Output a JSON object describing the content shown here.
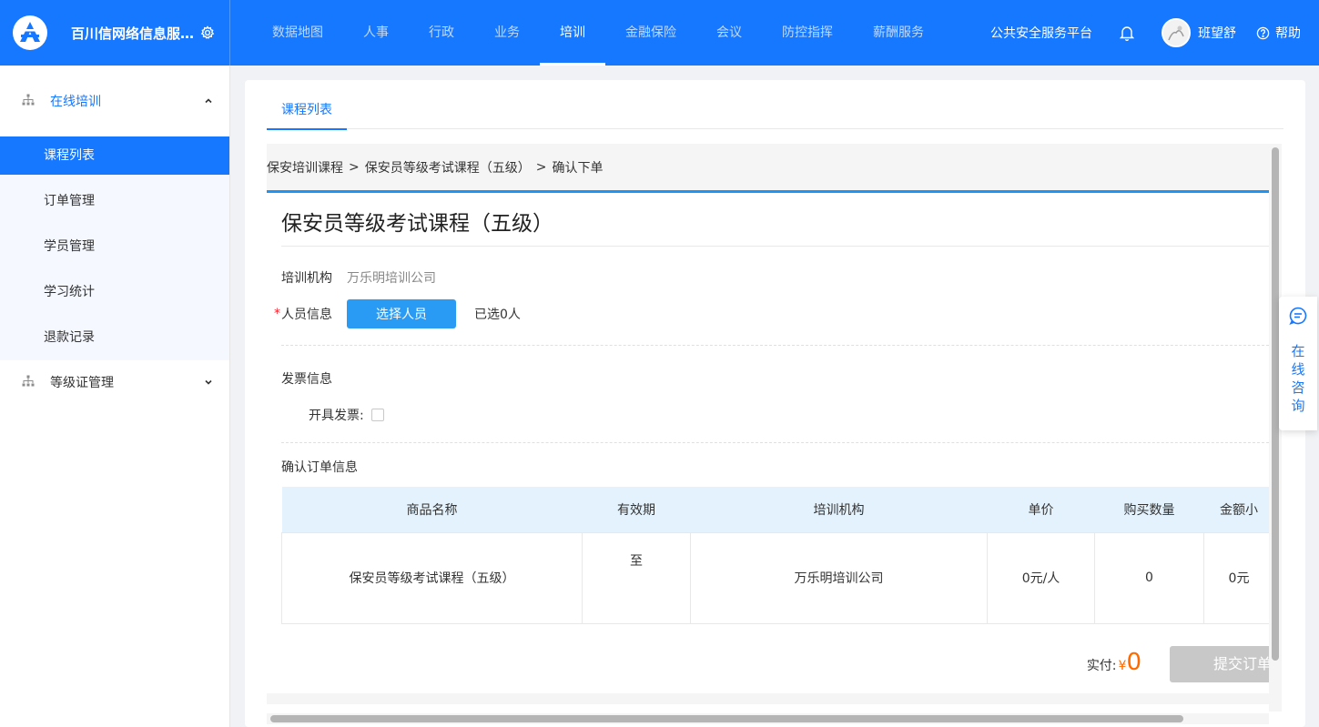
{
  "app": {
    "title": "百川信网络信息服务...",
    "platform": "公共安全服务平台",
    "username": "班望舒",
    "help": "帮助"
  },
  "nav": [
    {
      "label": "数据地图"
    },
    {
      "label": "人事"
    },
    {
      "label": "行政"
    },
    {
      "label": "业务"
    },
    {
      "label": "培训",
      "active": true
    },
    {
      "label": "金融保险"
    },
    {
      "label": "会议"
    },
    {
      "label": "防控指挥"
    },
    {
      "label": "薪酬服务"
    }
  ],
  "sidebar": {
    "group1": {
      "label": "在线培训",
      "items": [
        "课程列表",
        "订单管理",
        "学员管理",
        "学习统计",
        "退款记录"
      ]
    },
    "group2": {
      "label": "等级证管理"
    }
  },
  "tab": {
    "label": "课程列表"
  },
  "breadcrumb": [
    "保安培训课程",
    "保安员等级考试课程（五级）",
    "确认下单"
  ],
  "breadcrumb_sep": ">",
  "course": {
    "title": "保安员等级考试课程（五级）"
  },
  "form": {
    "org_label": "培训机构",
    "org_value": "万乐明培训公司",
    "required_mark": "*",
    "person_label": "人员信息",
    "select_button": "选择人员",
    "selected_text": "已选0人",
    "invoice_section": "发票信息",
    "invoice_label": "开具发票:",
    "confirm_section": "确认订单信息"
  },
  "table": {
    "headers": [
      "商品名称",
      "有效期",
      "培训机构",
      "单价",
      "购买数量",
      "金额小"
    ],
    "rows": [
      [
        "保安员等级考试课程（五级）",
        "至",
        "万乐明培训公司",
        "0元/人",
        "0",
        "0元"
      ]
    ]
  },
  "payment": {
    "label": "实付:",
    "currency": "¥",
    "amount": "0",
    "submit_button": "提交订单"
  },
  "consult": {
    "text": "在线咨询"
  },
  "colors": {
    "primary": "#1677ff",
    "accent_blue": "#2a9bf5",
    "price_orange": "#ff6a00",
    "disabled_gray": "#c8c8c8"
  }
}
